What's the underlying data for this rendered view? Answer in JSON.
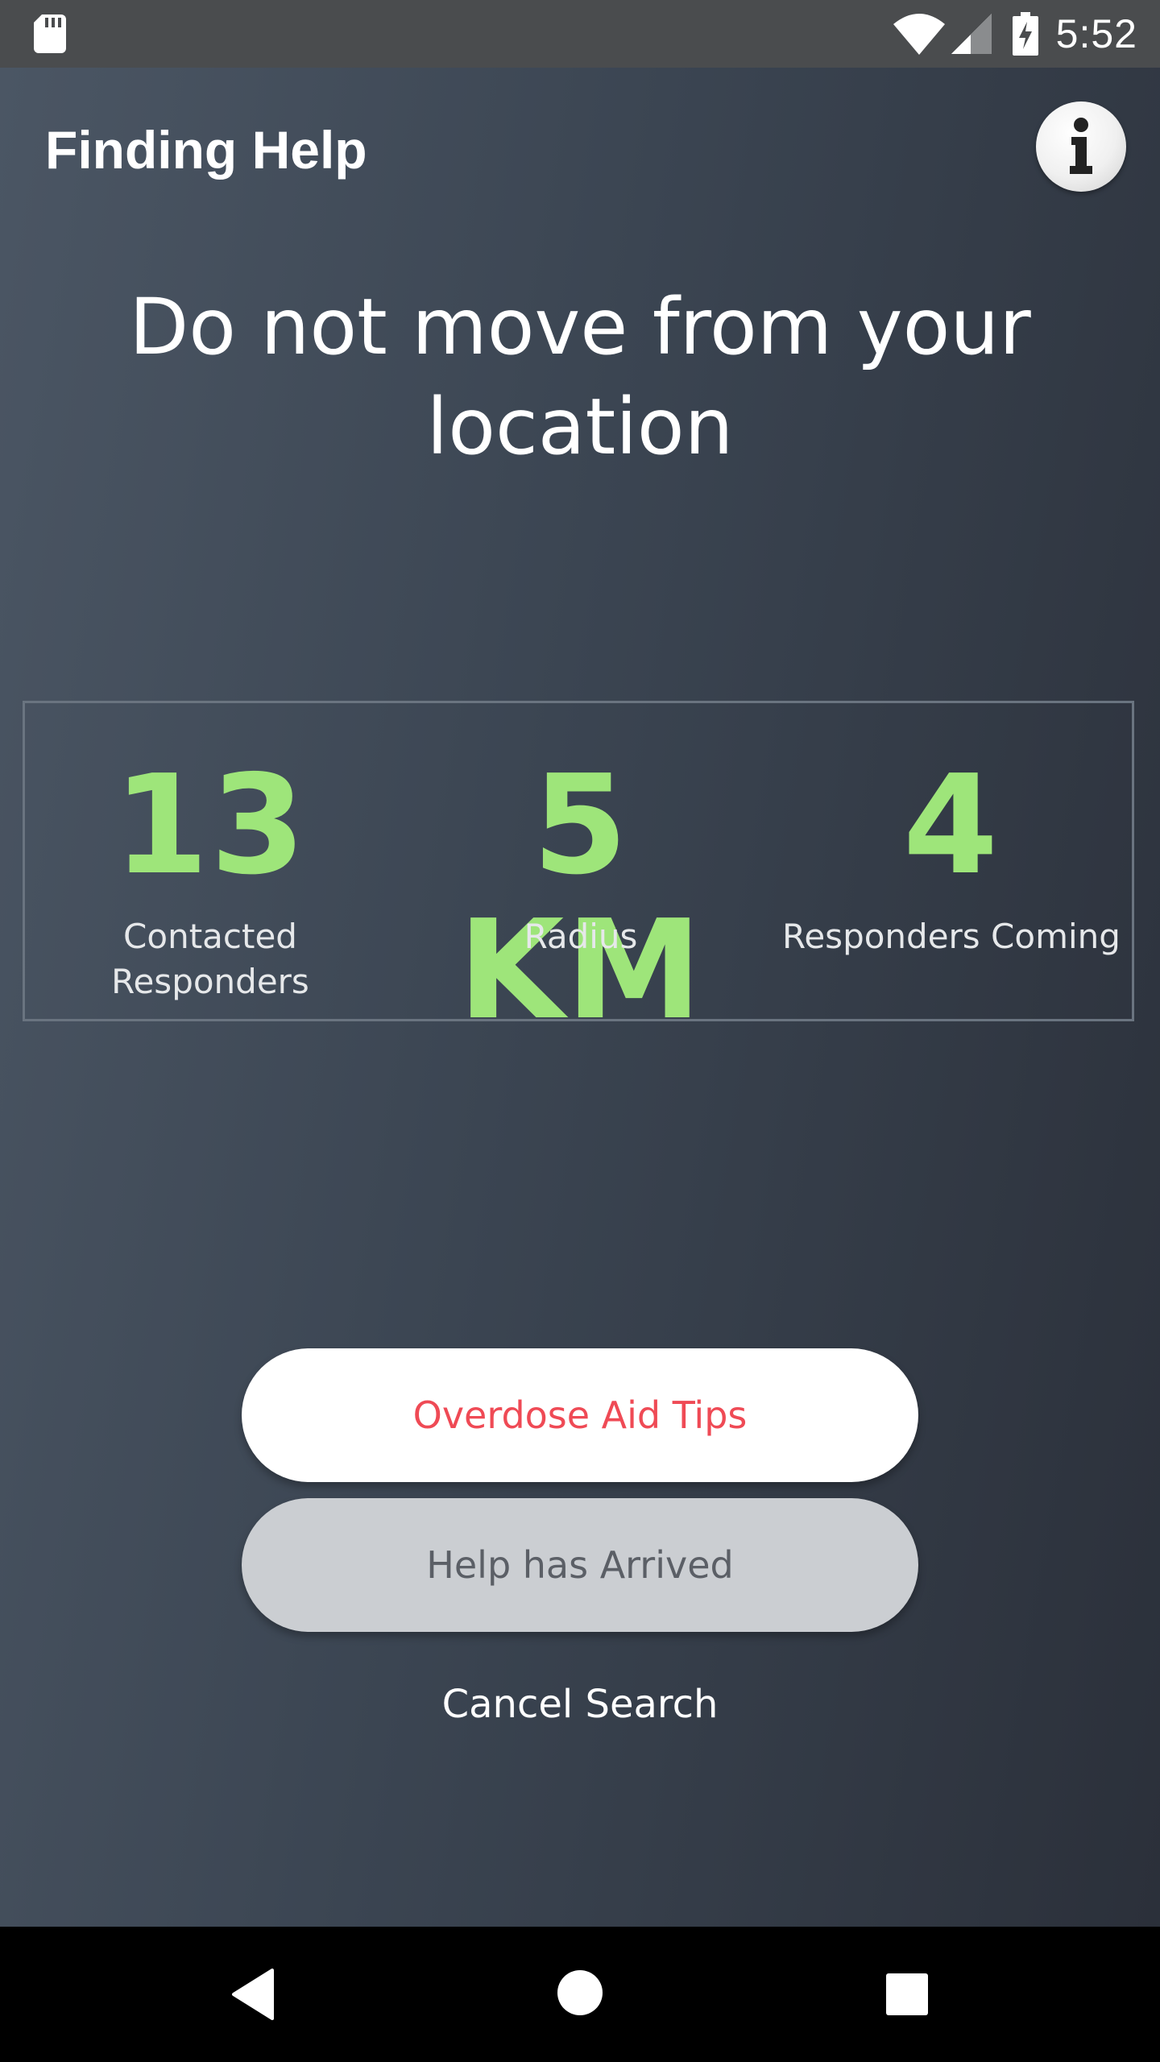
{
  "status_bar": {
    "time": "5:52",
    "icons": [
      "sd-card-icon",
      "wifi-icon",
      "signal-icon",
      "battery-charging-icon"
    ]
  },
  "header": {
    "title": "Finding Help",
    "info_icon": "info-icon"
  },
  "headline": "Do not move from your location",
  "stats": [
    {
      "value": "13",
      "label": "Contacted Responders"
    },
    {
      "value": "5 KM",
      "label": "Radius"
    },
    {
      "value": "4",
      "label": "Responders Coming"
    }
  ],
  "actions": {
    "tips_label": "Overdose Aid Tips",
    "arrived_label": "Help has Arrived",
    "cancel_label": "Cancel Search"
  },
  "nav_bar": {
    "icons": [
      "back-icon",
      "home-icon",
      "recents-icon"
    ]
  },
  "colors": {
    "accent_green": "#9ee57a",
    "tips_text": "#ef4a55",
    "background_start": "#4b5664",
    "background_end": "#2b303a"
  }
}
